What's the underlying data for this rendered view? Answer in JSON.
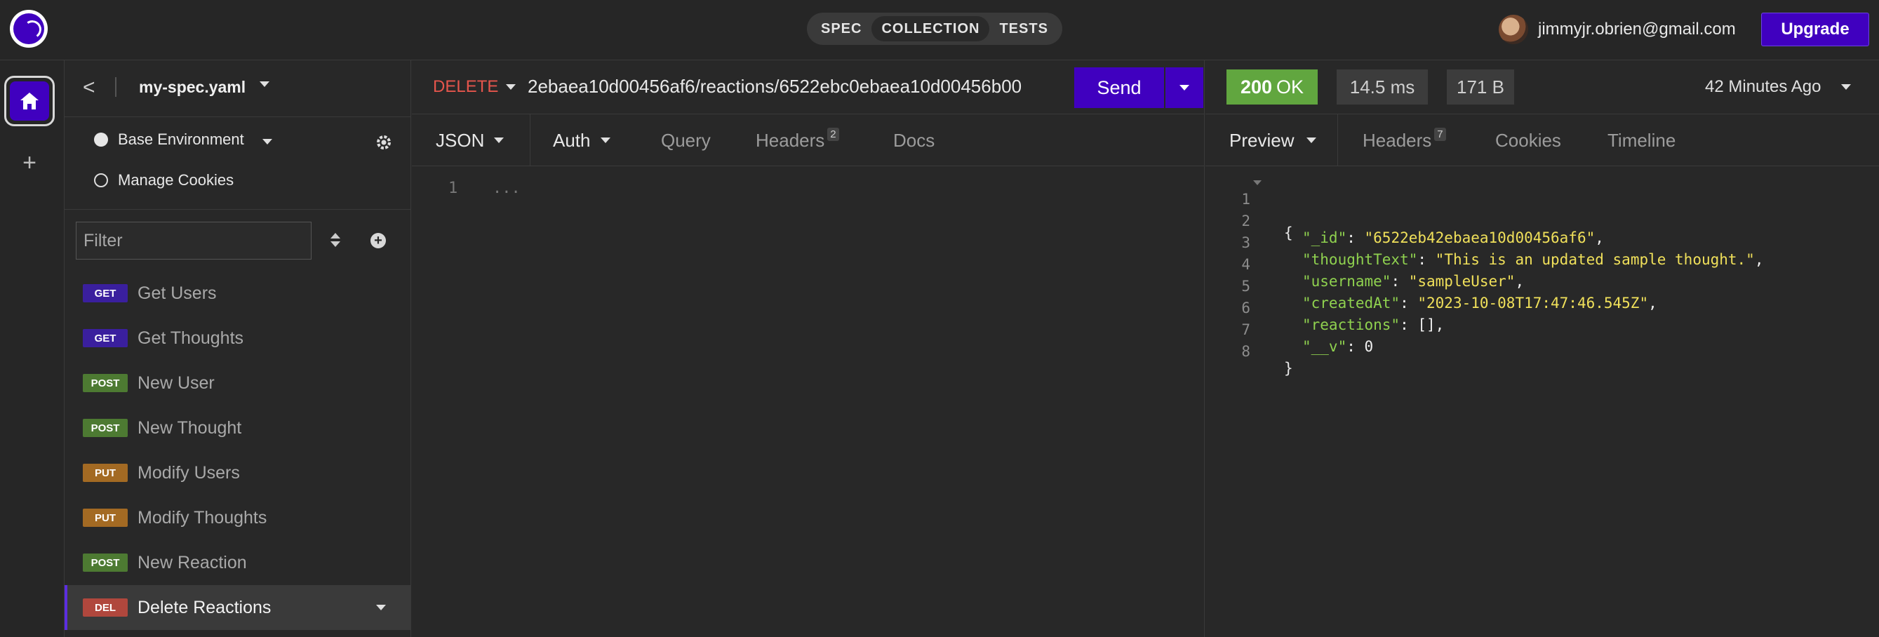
{
  "header": {
    "mode_tabs": [
      "SPEC",
      "COLLECTION",
      "TESTS"
    ],
    "active_mode": "COLLECTION",
    "user_email": "jimmyjr.obrien@gmail.com",
    "upgrade_label": "Upgrade"
  },
  "rail": {
    "home_icon": "home-icon",
    "add_icon": "+"
  },
  "sidebar": {
    "back_icon": "<",
    "title": "my-spec.yaml",
    "environment": "Base Environment",
    "manage_cookies": "Manage Cookies",
    "filter_placeholder": "Filter",
    "add_icon": "+",
    "requests": [
      {
        "method": "GET",
        "label": "Get Users",
        "color": "#3a1f9e"
      },
      {
        "method": "GET",
        "label": "Get Thoughts",
        "color": "#3a1f9e"
      },
      {
        "method": "POST",
        "label": "New User",
        "color": "#4d7a32"
      },
      {
        "method": "POST",
        "label": "New Thought",
        "color": "#4d7a32"
      },
      {
        "method": "PUT",
        "label": "Modify Users",
        "color": "#a36a23"
      },
      {
        "method": "PUT",
        "label": "Modify Thoughts",
        "color": "#a36a23"
      },
      {
        "method": "POST",
        "label": "New Reaction",
        "color": "#4d7a32"
      },
      {
        "method": "DEL",
        "label": "Delete Reactions",
        "color": "#b0473d",
        "active": true
      }
    ]
  },
  "request": {
    "method": "DELETE",
    "url": "2ebaea10d00456af6/reactions/6522ebc0ebaea10d00456b00",
    "send_label": "Send",
    "tabs": {
      "json": "JSON",
      "auth": "Auth",
      "query": "Query",
      "headers": "Headers",
      "headers_count": "2",
      "docs": "Docs"
    },
    "editor": {
      "line_number": "1",
      "placeholder": "..."
    }
  },
  "response": {
    "status_code": "200",
    "status_text": "OK",
    "time": "14.5 ms",
    "size": "171 B",
    "age": "42 Minutes Ago",
    "tabs": {
      "preview": "Preview",
      "headers": "Headers",
      "headers_count": "7",
      "cookies": "Cookies",
      "timeline": "Timeline"
    },
    "body_lines": [
      {
        "n": "1",
        "text": "{"
      },
      {
        "n": "2",
        "key": "\"_id\"",
        "value": "\"6522eb42ebaea10d00456af6\"",
        "value_type": "string",
        "trail": ","
      },
      {
        "n": "3",
        "key": "\"thoughtText\"",
        "value": "\"This is an updated sample thought.\"",
        "value_type": "string",
        "trail": ","
      },
      {
        "n": "4",
        "key": "\"username\"",
        "value": "\"sampleUser\"",
        "value_type": "string",
        "trail": ","
      },
      {
        "n": "5",
        "key": "\"createdAt\"",
        "value": "\"2023-10-08T17:47:46.545Z\"",
        "value_type": "string",
        "trail": ","
      },
      {
        "n": "6",
        "key": "\"reactions\"",
        "value": "[]",
        "value_type": "plain",
        "trail": ","
      },
      {
        "n": "7",
        "key": "\"__v\"",
        "value": "0",
        "value_type": "plain",
        "trail": ""
      },
      {
        "n": "8",
        "text": "}"
      }
    ]
  },
  "colors": {
    "accent": "#4000bf",
    "status_ok": "#61a63f",
    "delete_method": "#e5554c",
    "json_key": "#8fd14f",
    "json_string": "#f0e05a"
  }
}
